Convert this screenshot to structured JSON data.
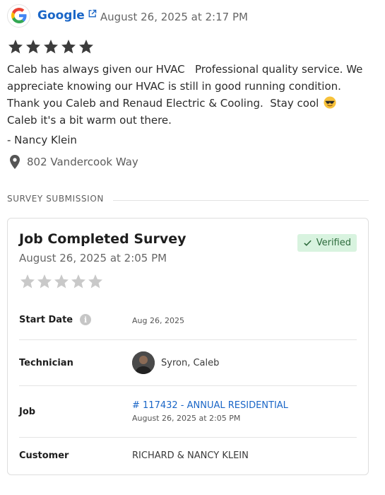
{
  "review": {
    "source_name": "Google",
    "source_icon": "google-g-icon",
    "link_icon": "external-link-icon",
    "timestamp": "August 26, 2025 at 2:17 PM",
    "rating": 5,
    "rating_max": 5,
    "text_1": "Caleb has always given our HVAC   Professional quality service. We appreciate knowing our HVAC is still in good running condition. Thank you Caleb and Renaud Electric & Cooling.  Stay cool",
    "emoji": "smiling-face-with-sunglasses",
    "text_2": " Caleb it's a bit warm out there.",
    "reviewer": "- Nancy Klein",
    "location_icon": "map-pin-icon",
    "location": "802 Vandercook Way"
  },
  "section": {
    "label": "SURVEY SUBMISSION"
  },
  "survey": {
    "title": "Job Completed Survey",
    "date": "August 26, 2025 at 2:05 PM",
    "verified_label": "Verified",
    "rating": 0,
    "rating_max": 5,
    "rows": {
      "start_date": {
        "label": "Start Date",
        "value": "Aug 26, 2025"
      },
      "technician": {
        "label": "Technician",
        "value": "Syron, Caleb"
      },
      "job": {
        "label": "Job",
        "link": "# 117432 - ANNUAL RESIDENTIAL",
        "sub": "August 26, 2025 at 2:05 PM"
      },
      "customer": {
        "label": "Customer",
        "value": "RICHARD & NANCY KLEIN"
      }
    }
  },
  "colors": {
    "link": "#1a66c7",
    "star_filled": "#3c3c3c",
    "star_empty": "#c9c9c9",
    "verified_bg": "#d8f3df",
    "verified_text": "#2d6b3c"
  }
}
